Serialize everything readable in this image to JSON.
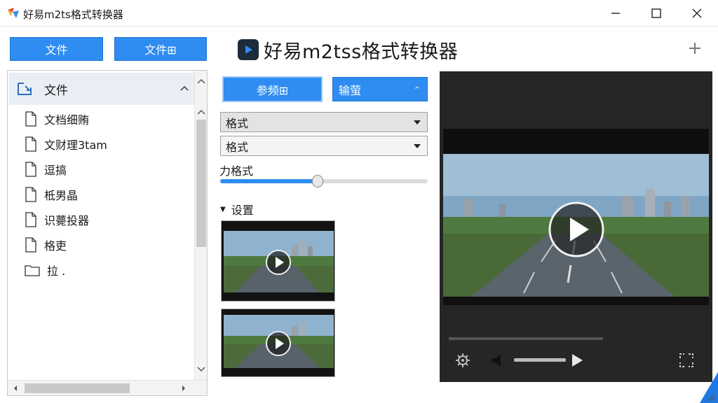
{
  "window": {
    "title": "好易m2ts格式转换器",
    "controls": {
      "minimize": "minimize",
      "maximize": "maximize",
      "close": "close"
    }
  },
  "toolbar": {
    "file_button_1": "文件",
    "file_button_2": "文件⊞"
  },
  "header": {
    "heading": "好易m2tss格式转换器"
  },
  "tree": {
    "header_label": "文件",
    "items": [
      {
        "label": "文档细贿",
        "type": "file"
      },
      {
        "label": "文财理3tam",
        "type": "file"
      },
      {
        "label": "逗搞",
        "type": "file"
      },
      {
        "label": "柢男晶",
        "type": "file"
      },
      {
        "label": "识薨投器",
        "type": "file"
      },
      {
        "label": "格吏",
        "type": "file"
      },
      {
        "label": "拉 .",
        "type": "folder"
      }
    ]
  },
  "controls": {
    "params_button": "参频⊞",
    "codec_button": "输萤",
    "format_select_1": "格式",
    "format_select_2": "格式",
    "slider_label": "力格式",
    "slider_value": 0.47,
    "section_label": "设置"
  },
  "player": {
    "progress": 0.0
  },
  "colors": {
    "accent": "#2f8cf0",
    "player_bg": "#262626",
    "corner": "#1e78e6"
  }
}
